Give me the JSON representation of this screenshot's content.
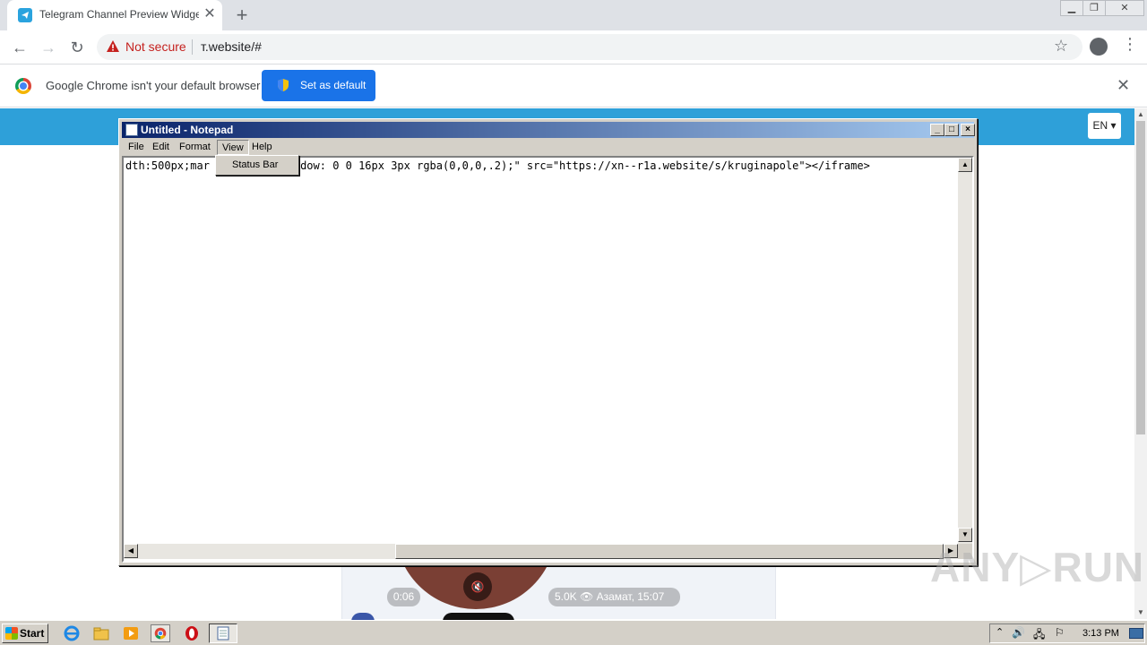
{
  "browser": {
    "tab_title": "Telegram Channel Preview Widget G",
    "new_tab": "+",
    "security_label": "Not secure",
    "url": "т.website/#",
    "infobar_text": "Google Chrome isn't your default browser",
    "set_default_label": "Set as default",
    "close_glyph": "✕"
  },
  "page": {
    "lang_label": "EN ▾",
    "video_time": "0:06",
    "video_meta": "5.0K 👁  Азамат, 15:07",
    "mute_glyph": "🔇"
  },
  "notepad": {
    "title": "Untitled - Notepad",
    "menus": [
      "File",
      "Edit",
      "Format",
      "View",
      "Help"
    ],
    "text": "dth:500px;mar          -shadow: 0 0 16px 3px rgba(0,0,0,.2);\" src=\"https://xn--r1a.website/s/kruginapole\"></iframe>",
    "dropdown_item": "Status Bar"
  },
  "watermark": "ANY▷RUN",
  "taskbar": {
    "start_label": "Start",
    "clock": "3:13 PM"
  },
  "colors": {
    "chrome_blue": "#1a73e8",
    "page_banner": "#2ea0d9",
    "notepad_title_start": "#0a246a",
    "not_secure_red": "#c5221f"
  }
}
